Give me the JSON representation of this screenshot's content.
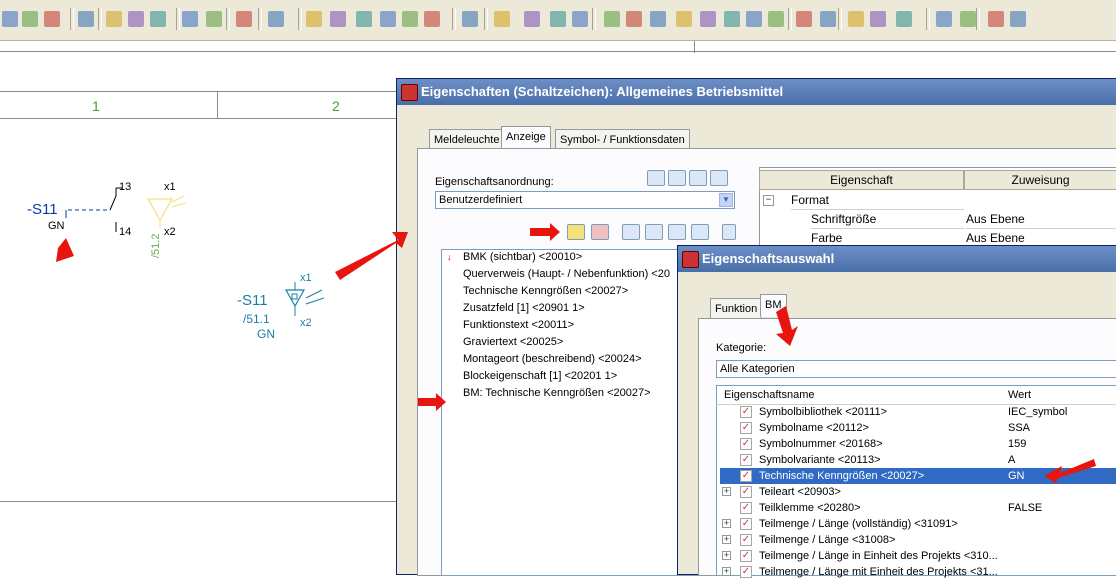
{
  "schematic": {
    "columns": [
      "1",
      "2"
    ],
    "symbol1": {
      "device": "-S11",
      "color_label": "GN",
      "contact_top": "13",
      "contact_bottom": "14",
      "lamp_x1": "x1",
      "lamp_x2": "x2",
      "lamp_ref": "/51.2"
    },
    "symbol2": {
      "device": "-S11",
      "ref": "/51.1",
      "color_label": "GN",
      "x1": "x1",
      "x2": "x2"
    }
  },
  "dialog_main": {
    "title": "Eigenschaften (Schaltzeichen): Allgemeines Betriebsmittel",
    "tabs": [
      "Meldeleuchte",
      "Anzeige",
      "Symbol- / Funktionsdaten"
    ],
    "active_tab": "Anzeige",
    "arrangement_label": "Eigenschaftsanordnung:",
    "arrangement_value": "Benutzerdefiniert",
    "property_list": [
      "BMK (sichtbar) <20010>",
      "Querverweis (Haupt- / Nebenfunktion) <20",
      "Technische Kenngrößen <20027>",
      "Zusatzfeld [1] <20901 1>",
      "Funktionstext <20011>",
      "Graviertext <20025>",
      "Montageort (beschreibend) <20024>",
      "Blockeigenschaft [1] <20201 1>",
      "BM: Technische Kenngrößen <20027>"
    ],
    "grid": {
      "headers": [
        "Eigenschaft",
        "Zuweisung"
      ],
      "rows": [
        {
          "name": "Format",
          "value": ""
        },
        {
          "name": "Schriftgröße",
          "value": "Aus Ebene"
        },
        {
          "name": "Farbe",
          "value": "Aus Ebene"
        }
      ]
    }
  },
  "dialog_select": {
    "title": "Eigenschaftsauswahl",
    "tabs": [
      "Funktion",
      "BM"
    ],
    "active_tab": "BM",
    "category_label": "Kategorie:",
    "category_value": "Alle Kategorien",
    "headers": [
      "Eigenschaftsname",
      "Wert"
    ],
    "rows": [
      {
        "name": "Symbolbibliothek <20111>",
        "value": "IEC_symbol",
        "expand": false
      },
      {
        "name": "Symbolname <20112>",
        "value": "SSA",
        "expand": false
      },
      {
        "name": "Symbolnummer <20168>",
        "value": "159",
        "expand": false
      },
      {
        "name": "Symbolvariante <20113>",
        "value": "A",
        "expand": false
      },
      {
        "name": "Technische Kenngrößen <20027>",
        "value": "GN",
        "expand": false,
        "selected": true
      },
      {
        "name": "Teileart <20903>",
        "value": "",
        "expand": true
      },
      {
        "name": "Teilklemme <20280>",
        "value": "FALSE",
        "expand": false
      },
      {
        "name": "Teilmenge / Länge (vollständig) <31091>",
        "value": "",
        "expand": true
      },
      {
        "name": "Teilmenge / Länge <31008>",
        "value": "",
        "expand": true
      },
      {
        "name": "Teilmenge / Länge in Einheit des Projekts <310...",
        "value": "",
        "expand": true
      },
      {
        "name": "Teilmenge / Länge mit Einheit des Projekts <31...",
        "value": "",
        "expand": true
      }
    ]
  },
  "colors": {
    "accent_blue": "#0a3c9e",
    "teal": "#1b7fa3",
    "arrow_red": "#e8150f",
    "title_bar": "#4a6fa8",
    "selection": "#316ac5"
  }
}
